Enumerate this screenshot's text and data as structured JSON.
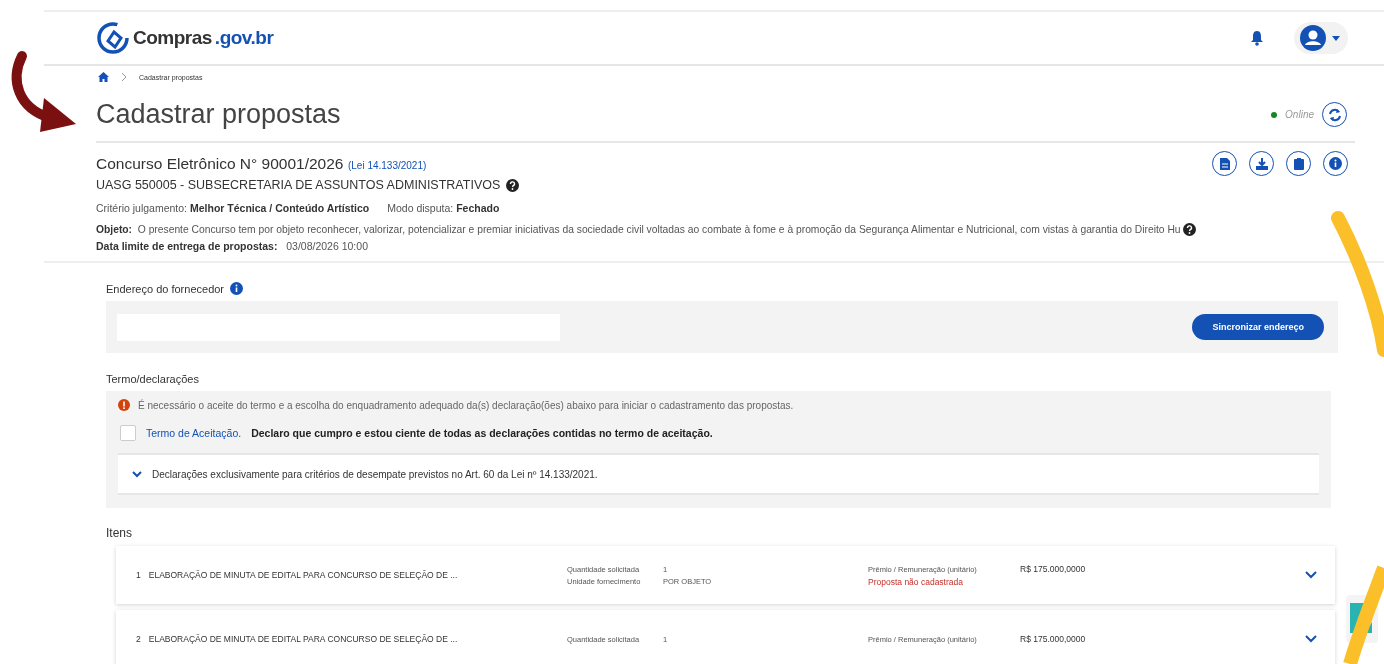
{
  "header": {
    "logo_main": "Compras",
    "logo_domain": ".gov.br"
  },
  "breadcrumb": [
    "Cadastrar propostas"
  ],
  "page_title": "Cadastrar propostas",
  "connection": {
    "status": "Online",
    "online": true
  },
  "procurement": {
    "title": "Concurso Eletrônico N° 90001/2026",
    "law_link": "(Lei 14.133/2021)",
    "uasg": "UASG 550005 - SUBSECRETARIA DE ASSUNTOS ADMINISTRATIVOS",
    "criteria": [
      {
        "label": "Critério julgamento:",
        "value": "Melhor Técnica / Conteúdo Artístico"
      },
      {
        "label": "Modo disputa:",
        "value": "Fechado"
      }
    ],
    "object": {
      "label": "Objeto:",
      "text": "O presente Concurso tem por objeto reconhecer, valorizar, potencializar e premiar iniciativas da sociedade civil voltadas ao combate à fome e à promoção da Segurança Alimentar e Nutricional, com vistas à garantia do Direito Hu"
    },
    "deadline": {
      "label": "Data limite de entrega de propostas:",
      "value": "03/08/2026 10:00"
    }
  },
  "address": {
    "label": "Endereço do fornecedor",
    "button": "Sincronizar endereço"
  },
  "terms": {
    "heading": "Termo/declarações",
    "warning": "É necessário o aceite do termo e a escolha do enquadramento adequado da(s) declaração(ões) abaixo para iniciar o cadastramento das propostas.",
    "acceptance": {
      "checked": false,
      "link": "Termo de Aceitação.",
      "text": "Declaro que cumpro e estou ciente de todas as declarações contidas no termo de aceitação."
    },
    "accordion": {
      "expanded": false,
      "label": "Declarações exclusivamente para critérios de desempate previstos no Art. 60 da Lei nº 14.133/2021."
    }
  },
  "items": {
    "heading": "Itens",
    "list": [
      {
        "number": "1",
        "name": "ELABORAÇÃO DE MINUTA DE EDITAL PARA CONCURSO DE SELEÇÃO DE ...",
        "qty_label": "Quantidade solicitada",
        "qty": "1",
        "unit_label": "Unidade fornecimento",
        "unit": "POR OBJETO",
        "price_label": "Prêmio / Remuneração (unitário)",
        "price": "R$ 175.000,0000",
        "status": "Proposta não cadastrada",
        "expanded": false
      },
      {
        "number": "2",
        "name": "ELABORAÇÃO DE MINUTA DE EDITAL PARA CONCURSO DE SELEÇÃO DE ...",
        "qty_label": "Quantidade solicitada",
        "qty": "1",
        "price_label": "Prêmio / Remuneração (unitário)",
        "price": "R$ 175.000,0000",
        "expanded": false
      }
    ]
  }
}
